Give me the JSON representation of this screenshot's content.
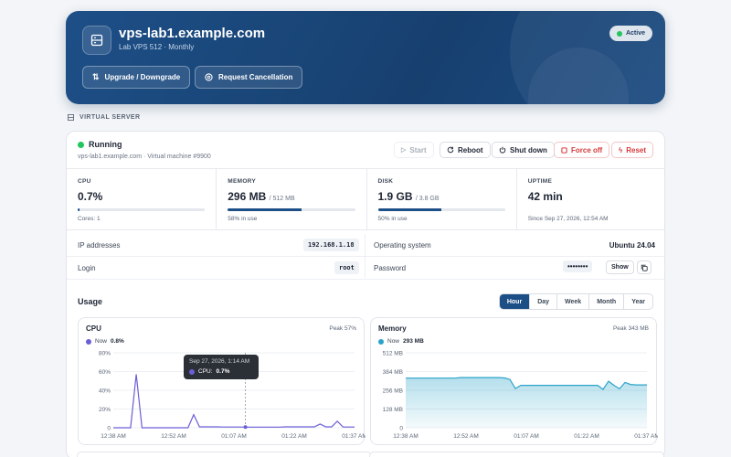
{
  "header": {
    "hostname": "vps-lab1.example.com",
    "subtitle": "Lab VPS 512 · Monthly",
    "status_badge": "Active",
    "upgrade_label": "Upgrade / Downgrade",
    "cancel_label": "Request Cancellation"
  },
  "section_label": "VIRTUAL SERVER",
  "server": {
    "status": "Running",
    "details": "vps-lab1.example.com · Virtual machine #9900",
    "actions": {
      "start": "Start",
      "reboot": "Reboot",
      "shutdown": "Shut down",
      "force_off": "Force off",
      "reset": "Reset"
    }
  },
  "metrics": {
    "cpu": {
      "label": "CPU",
      "value": "0.7%",
      "sub": "Cores: 1",
      "fill": 0.007
    },
    "memory": {
      "label": "MEMORY",
      "value": "296 MB",
      "total": "/ 512 MB",
      "sub": "58% in use",
      "fill": 0.58
    },
    "disk": {
      "label": "DISK",
      "value": "1.9 GB",
      "total": "/ 3.8 GB",
      "sub": "50% in use",
      "fill": 0.5
    },
    "uptime": {
      "label": "UPTIME",
      "value": "42 min",
      "sub": "Since Sep 27, 2026, 12:54 AM"
    }
  },
  "info": {
    "ip_label": "IP addresses",
    "ip_value": "192.168.1.18",
    "os_label": "Operating system",
    "os_value": "Ubuntu 24.04",
    "login_label": "Login",
    "login_value": "root",
    "password_label": "Password",
    "password_value": "••••••••",
    "show_label": "Show"
  },
  "usage": {
    "title": "Usage",
    "ranges": [
      "Hour",
      "Day",
      "Week",
      "Month",
      "Year"
    ],
    "active_range": "Hour"
  },
  "colors": {
    "primary": "#1d4f87",
    "cpu_line": "#6a5fd6",
    "memory_line": "#2aa3c9",
    "active_green": "#22c55e",
    "danger": "#d63b3b"
  },
  "charts": {
    "cpu": {
      "title": "CPU",
      "peak": "Peak 57%",
      "now_label": "Now",
      "now_value": "0.8%",
      "tooltip_time": "Sep 27, 2026, 1:14 AM",
      "tooltip_label": "CPU:",
      "tooltip_value": "0.7%"
    },
    "memory": {
      "title": "Memory",
      "peak": "Peak 343 MB",
      "now_label": "Now",
      "now_value": "293 MB"
    }
  },
  "chart_data": [
    {
      "type": "line",
      "title": "CPU",
      "ylim": [
        0,
        80
      ],
      "yticks": [
        "0",
        "20%",
        "40%",
        "60%",
        "80%"
      ],
      "xticks": [
        "12:38 AM",
        "12:52 AM",
        "01:07 AM",
        "01:22 AM",
        "01:37 AM"
      ],
      "series": [
        {
          "name": "CPU",
          "values": [
            0,
            0,
            0,
            0,
            57,
            0,
            0,
            0,
            0,
            0,
            0,
            0,
            0,
            0,
            14,
            1,
            1,
            1,
            1,
            0.8,
            0.8,
            0.8,
            0.8,
            0.7,
            0.7,
            0.7,
            0.7,
            0.7,
            0.7,
            0.7,
            1,
            1,
            1,
            1,
            1,
            1,
            4,
            1,
            1,
            7,
            0.8,
            0.8,
            0.8
          ]
        }
      ]
    },
    {
      "type": "area",
      "title": "Memory",
      "ylim": [
        0,
        512
      ],
      "yticks": [
        "0",
        "128 MB",
        "256 MB",
        "384 MB",
        "512 MB"
      ],
      "xticks": [
        "12:38 AM",
        "12:52 AM",
        "01:07 AM",
        "01:22 AM",
        "01:37 AM"
      ],
      "series": [
        {
          "name": "Memory",
          "values": [
            339,
            339,
            339,
            339,
            339,
            339,
            339,
            339,
            339,
            339,
            343,
            343,
            343,
            343,
            343,
            343,
            343,
            343,
            340,
            330,
            268,
            290,
            290,
            290,
            290,
            290,
            290,
            290,
            290,
            290,
            290,
            290,
            290,
            290,
            290,
            290,
            262,
            318,
            290,
            266,
            310,
            296,
            293,
            293,
            293
          ]
        }
      ]
    }
  ]
}
